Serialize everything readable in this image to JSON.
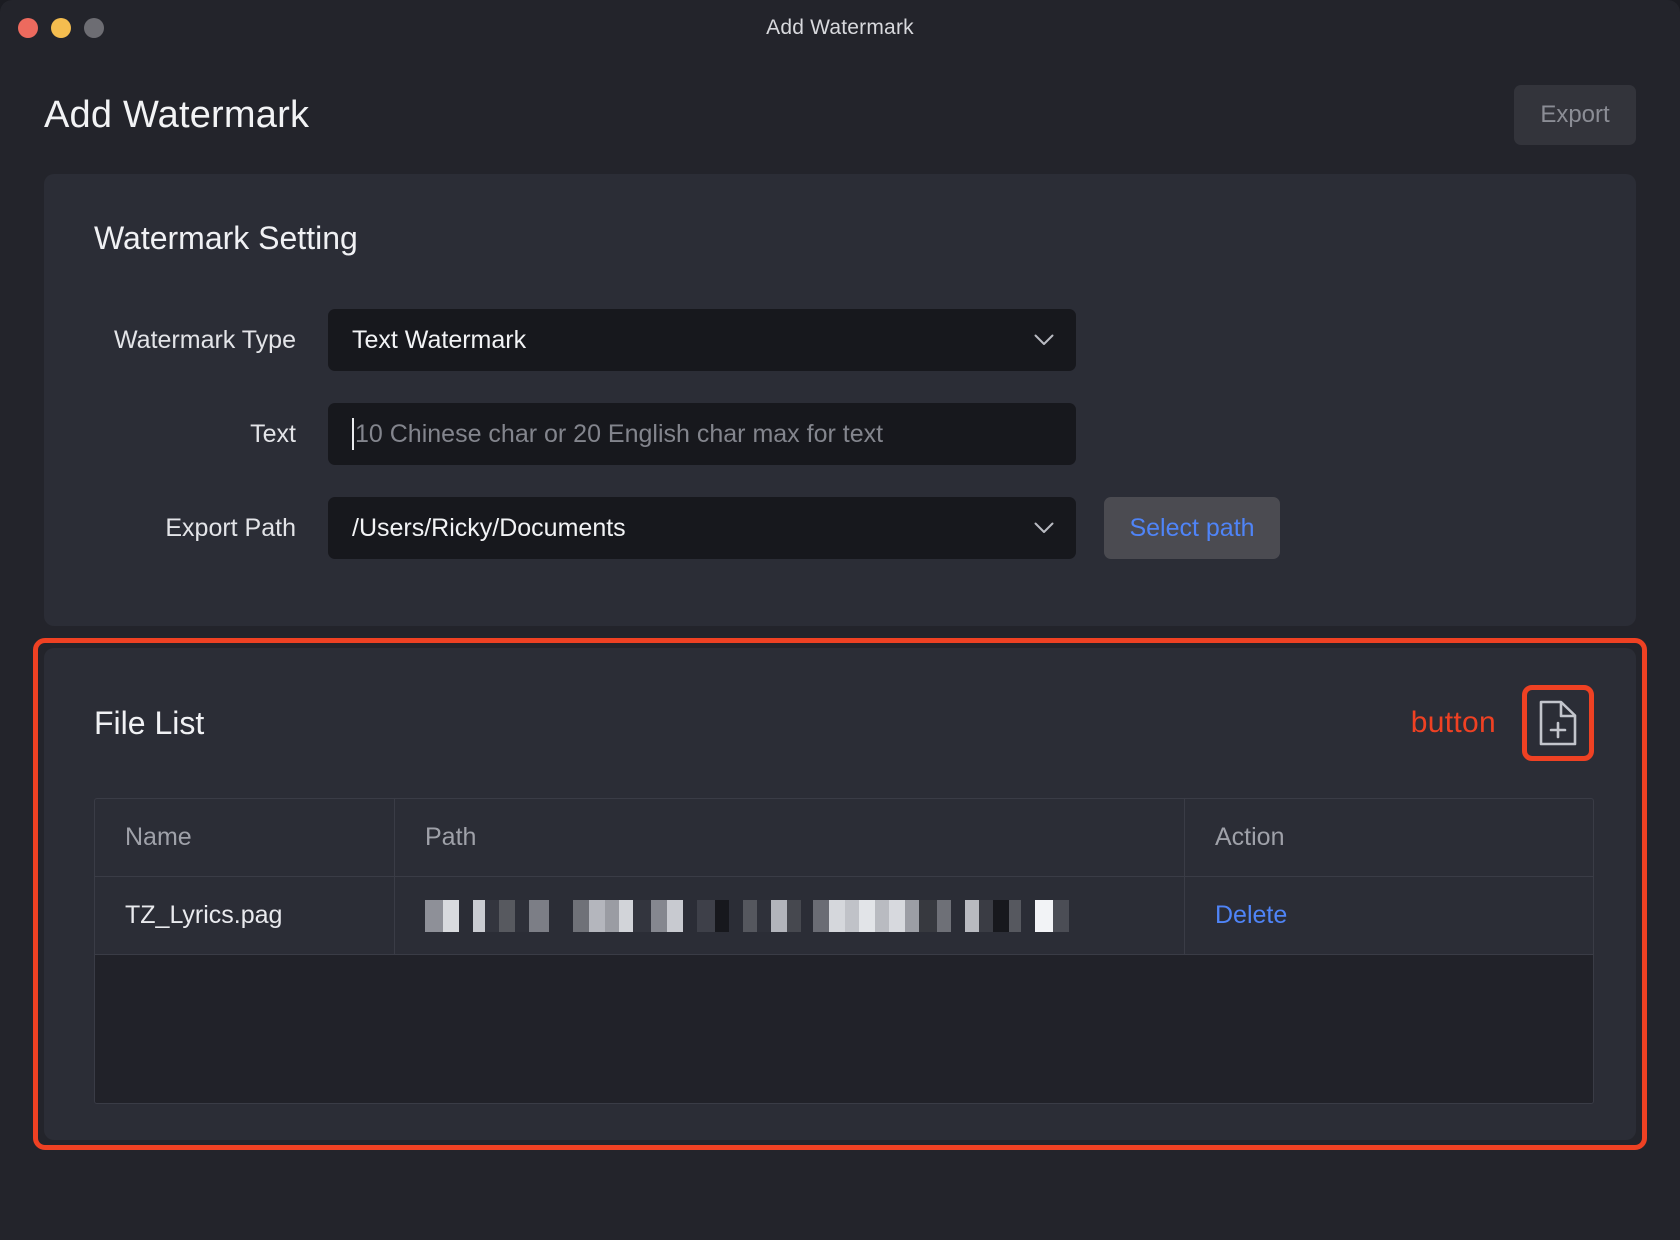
{
  "window": {
    "titlebar_title": "Add Watermark",
    "traffic_lights": [
      {
        "name": "close",
        "color": "#ed6a5e"
      },
      {
        "name": "minimize",
        "color": "#f4bd4f"
      },
      {
        "name": "maximize",
        "color": "#6d6d73"
      }
    ]
  },
  "header": {
    "page_title": "Add Watermark",
    "export_label": "Export"
  },
  "setting": {
    "section_title": "Watermark Setting",
    "rows": {
      "type": {
        "label": "Watermark Type",
        "value": "Text Watermark",
        "chevron_icon": "chevron-down-icon"
      },
      "text": {
        "label": "Text",
        "value": "",
        "placeholder": "10 Chinese char or 20 English char max for text"
      },
      "export_path": {
        "label": "Export Path",
        "value": "/Users/Ricky/Documents",
        "chevron_icon": "chevron-down-icon",
        "select_button_label": "Select path"
      }
    }
  },
  "file_list": {
    "title": "File List",
    "annotation_label": "button",
    "add_button_icon": "file-plus-icon",
    "columns": [
      "Name",
      "Path",
      "Action"
    ],
    "rows": [
      {
        "name": "TZ_Lyrics.pag",
        "path": "",
        "path_redacted": true,
        "action": "Delete"
      }
    ]
  },
  "colors": {
    "annotation": "#ef4123",
    "accent_link": "#4f84f7",
    "panel": "#2b2d36",
    "window_bg": "#23242b",
    "field_bg": "#17181d"
  }
}
